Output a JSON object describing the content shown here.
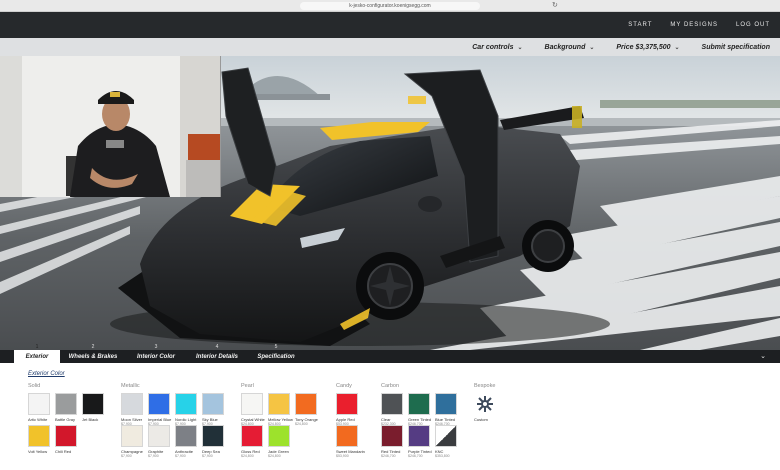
{
  "browser": {
    "url": "k-jesko-configurator.koenigsegg.com"
  },
  "header": {
    "nav": [
      "START",
      "MY DESIGNS",
      "LOG OUT"
    ]
  },
  "menu": {
    "items": [
      "Car controls",
      "Background",
      "Price $3,375,500",
      "Submit specification"
    ]
  },
  "tabs": [
    {
      "num": "1",
      "label": "Exterior",
      "active": true
    },
    {
      "num": "2",
      "label": "Wheels & Brakes",
      "active": false
    },
    {
      "num": "3",
      "label": "Interior Color",
      "active": false
    },
    {
      "num": "4",
      "label": "Interior Details",
      "active": false
    },
    {
      "num": "5",
      "label": "Specification",
      "active": false
    }
  ],
  "panel": {
    "title": "Exterior Color",
    "groups": [
      {
        "label": "Solid",
        "swatches": [
          {
            "name": "Artic White",
            "price": "",
            "color": "#f4f4f4"
          },
          {
            "name": "Battle Gray",
            "price": "",
            "color": "#9a9c9d"
          },
          {
            "name": "Jet Black",
            "price": "",
            "color": "#18191a"
          },
          {
            "name": "Volt Yellow",
            "price": "",
            "color": "#f1c22a"
          },
          {
            "name": "Chili Red",
            "price": "",
            "color": "#d2172b"
          }
        ]
      },
      {
        "label": "Metallic",
        "swatches": [
          {
            "name": "Moon Silver",
            "price": "$7,900",
            "color": "#d6d9dd"
          },
          {
            "name": "Imperial Blue",
            "price": "$7,900",
            "color": "#2f6ee6"
          },
          {
            "name": "Nordic Light",
            "price": "$7,900",
            "color": "#27d2e8"
          },
          {
            "name": "Sky Blue",
            "price": "$7,900",
            "color": "#a4c4de"
          },
          {
            "name": "Champagne",
            "price": "$7,900",
            "color": "#f0ebe0"
          },
          {
            "name": "Graphite",
            "price": "$7,900",
            "color": "#eceae6"
          },
          {
            "name": "Anthracite",
            "price": "$7,900",
            "color": "#7d8086"
          },
          {
            "name": "Deep Sea",
            "price": "$7,900",
            "color": "#213038"
          }
        ]
      },
      {
        "label": "Pearl",
        "swatches": [
          {
            "name": "Crystal White",
            "price": "$24,800",
            "color": "#f6f6f4"
          },
          {
            "name": "Mellow Yellow",
            "price": "$24,800",
            "color": "#f5c443"
          },
          {
            "name": "Tony Orange",
            "price": "$24,800",
            "color": "#f26b20"
          },
          {
            "name": "Gloss Red",
            "price": "$24,800",
            "color": "#e51c34"
          },
          {
            "name": "Jade Green",
            "price": "$24,800",
            "color": "#9de22c"
          }
        ]
      },
      {
        "label": "Candy",
        "swatches": [
          {
            "name": "Apple Red",
            "price": "$53,900",
            "color": "#ea1f2d"
          },
          {
            "name": "Sweet Mandarin",
            "price": "$53,900",
            "color": "#f26a1f"
          }
        ]
      },
      {
        "label": "Carbon",
        "swatches": [
          {
            "name": "Clear",
            "price": "$232,300",
            "color": "#4f5255"
          },
          {
            "name": "Green Tinted",
            "price": "$246,700",
            "color": "#1e6c4e"
          },
          {
            "name": "Blue Tinted",
            "price": "$246,700",
            "color": "#2f6f9c"
          },
          {
            "name": "Red Tinted",
            "price": "$246,700",
            "color": "#7a1d2d"
          },
          {
            "name": "Purple Tinted",
            "price": "$246,700",
            "color": "#553c83"
          },
          {
            "name": "KNC",
            "price": "$353,800",
            "color": "#3a3c3f"
          }
        ]
      },
      {
        "label": "Bespoke",
        "swatches": [
          {
            "name": "Custom",
            "price": "",
            "color": "#ffffff"
          }
        ]
      }
    ]
  },
  "colors": {
    "header_bg": "#26292c",
    "accent_yellow": "#f1c22a",
    "car_body": "#2a2c2f"
  }
}
